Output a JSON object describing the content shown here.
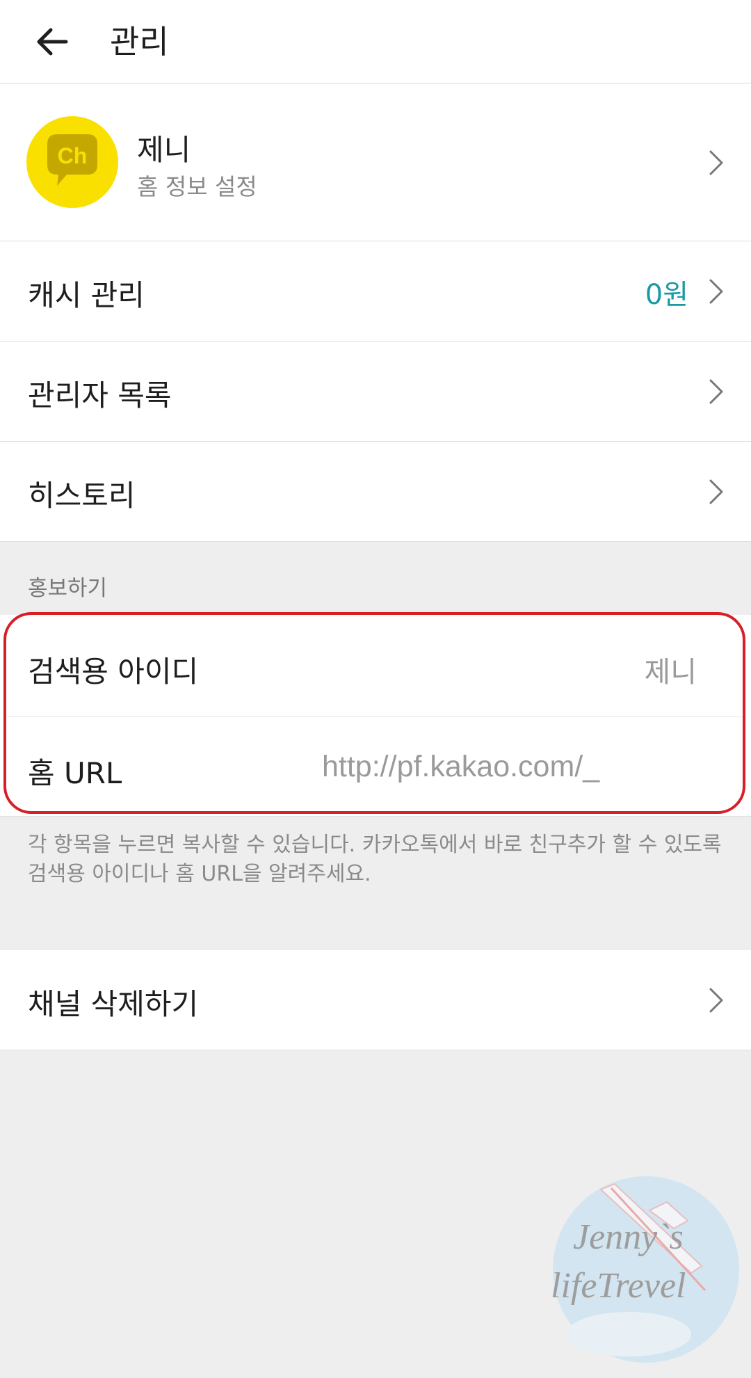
{
  "header": {
    "title": "관리"
  },
  "profile": {
    "avatar_text": "Ch",
    "name": "제니",
    "subtitle": "홈 정보 설정"
  },
  "menu": {
    "cash": {
      "label": "캐시 관리",
      "value": "0원"
    },
    "admins": {
      "label": "관리자 목록"
    },
    "history": {
      "label": "히스토리"
    }
  },
  "promo": {
    "section_title": "홍보하기",
    "search_id": {
      "label": "검색용 아이디",
      "value": "제니"
    },
    "home_url": {
      "label": "홈 URL",
      "value": "http://pf.kakao.com/_"
    },
    "help_text": "각 항목을 누르면 복사할 수 있습니다. 카카오톡에서 바로 친구추가 할 수 있도록 검색용 아이디나 홈 URL을 알려주세요."
  },
  "delete": {
    "label": "채널 삭제하기"
  },
  "watermark": {
    "line1": "Jenny`s",
    "line2": "lifeTrevel"
  },
  "colors": {
    "accent_value": "#1a9aa8",
    "avatar_bg": "#f9e000",
    "highlight": "#d61f26"
  }
}
